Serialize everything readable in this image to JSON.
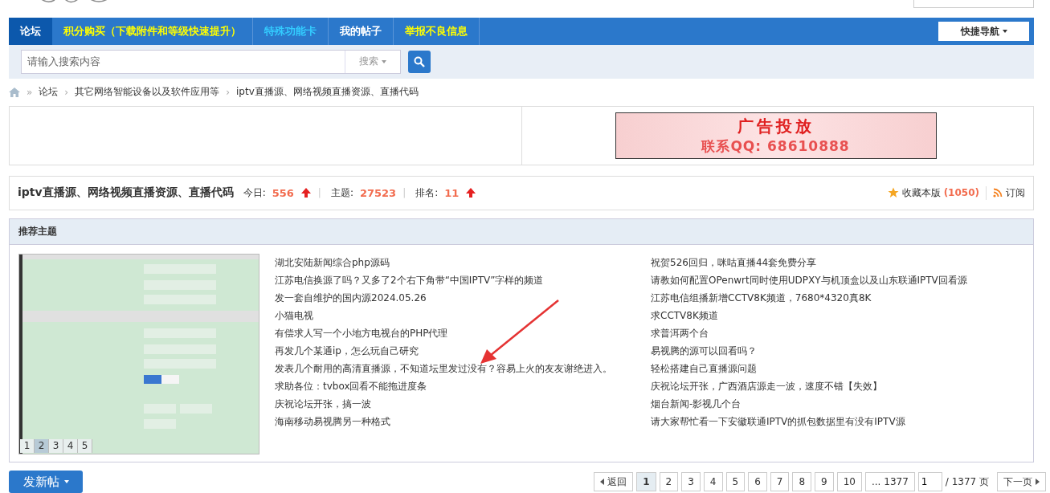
{
  "nav": {
    "items": [
      {
        "label": "论坛",
        "selected": true,
        "kind": "plain"
      },
      {
        "label": "积分购买（下载附件和等级快速提升）",
        "selected": false,
        "kind": "promo"
      },
      {
        "label": "特殊功能卡",
        "selected": false,
        "kind": "special"
      },
      {
        "label": "我的帖子",
        "selected": false,
        "kind": "plain"
      },
      {
        "label": "举报不良信息",
        "selected": false,
        "kind": "promo"
      }
    ],
    "quick_nav": "快捷导航"
  },
  "search": {
    "placeholder": "请输入搜索内容",
    "type_select": "搜索"
  },
  "breadcrumb_home_separator": "»",
  "breadcrumb_separator": "›",
  "breadcrumb": [
    "论坛",
    "其它网络智能设备以及软件应用等",
    "iptv直播源、网络视频直播资源、直播代码"
  ],
  "ad": {
    "title": "广告投放",
    "contact": "联系QQ: 68610888"
  },
  "forum": {
    "stat_divider": "|",
    "name": "iptv直播源、网络视频直播资源、直播代码",
    "stats": [
      {
        "label": "今日:",
        "value": "556",
        "arrow": true
      },
      {
        "label": "主题:",
        "value": "27523",
        "arrow": false
      },
      {
        "label": "排名:",
        "value": "11",
        "arrow": true
      }
    ],
    "favorite": "收藏本版",
    "favorite_count": "(1050)",
    "subscribe": "订阅"
  },
  "recommended": {
    "title": "推荐主题",
    "slides": [
      {
        "label": "1",
        "selected": false
      },
      {
        "label": "2",
        "selected": true
      },
      {
        "label": "3",
        "selected": false
      },
      {
        "label": "4",
        "selected": false
      },
      {
        "label": "5",
        "selected": false
      }
    ],
    "topics_left": [
      "湖北安陆新闻综合php源码",
      "江苏电信换源了吗？又多了2个右下角带“中国IPTV”字样的频道",
      "发一套自维护的国内源2024.05.26",
      "小猫电视",
      "有偿求人写一个小地方电视台的PHP代理",
      "再发几个某通ip，怎么玩自己研究",
      "发表几个耐用的高清直播源，不知道坛里发过没有？容易上火的友友谢绝进入。",
      "求助各位：tvbox回看不能拖进度条",
      "庆祝论坛开张，搞一波",
      "海南移动易视腾另一种格式"
    ],
    "topics_right": [
      "祝贺526回归，咪咕直播44套免费分享",
      "请教如何配置OPenwrt同时使用UDPXY与机顶盒以及山东联通IPTV回看源",
      "江苏电信组播新增CCTV8K频道，7680*4320真8K",
      "求CCTV8K频道",
      "求普洱两个台",
      "易视腾的源可以回看吗？",
      "轻松搭建自己直播源问题",
      "庆祝论坛开张，广西酒店源走一波，速度不错【失效】",
      "烟台新闻-影视几个台",
      "请大家帮忙看一下安徽联通IPTV的抓包数据里有没有IPTV源"
    ]
  },
  "new_post_button": "发新帖",
  "pagination": {
    "back": "返回",
    "pages": [
      {
        "label": "1",
        "selected": true
      },
      {
        "label": "2",
        "selected": false
      },
      {
        "label": "3",
        "selected": false
      },
      {
        "label": "4",
        "selected": false
      },
      {
        "label": "5",
        "selected": false
      },
      {
        "label": "6",
        "selected": false
      },
      {
        "label": "7",
        "selected": false
      },
      {
        "label": "8",
        "selected": false
      },
      {
        "label": "9",
        "selected": false
      },
      {
        "label": "10",
        "selected": false
      },
      {
        "label": "... 1377",
        "selected": false
      }
    ],
    "page_input": "1",
    "total": "/ 1377 页",
    "next": "下一页"
  }
}
